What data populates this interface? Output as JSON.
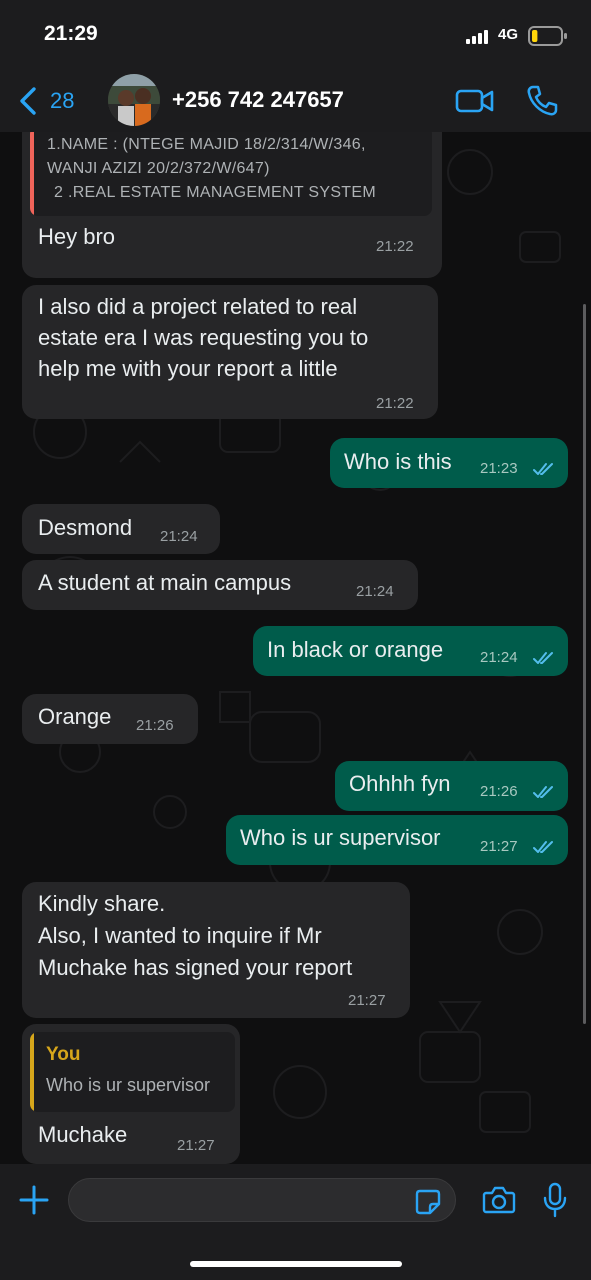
{
  "status_bar": {
    "time": "21:29",
    "network": "4G",
    "battery_level": 0.2,
    "battery_color": "#ffd60a"
  },
  "header": {
    "back_count": "28",
    "contact": "+256 742 247657",
    "accent": "#2aa4f4"
  },
  "messages": [
    {
      "direction": "in",
      "quoted_lines": [
        "1.NAME : (NTEGE MAJID 18/2/314/W/346,",
        "WANJI AZIZI 20/2/372/W/647)",
        "2 .REAL ESTATE MANAGEMENT SYSTEM"
      ],
      "text": "Hey bro",
      "time": "21:22"
    },
    {
      "direction": "in",
      "lines": [
        "I also did a project related to real",
        "estate era I was requesting you to",
        "help me with your report a little"
      ],
      "time": "21:22"
    },
    {
      "direction": "out",
      "text": "Who is this",
      "time": "21:23"
    },
    {
      "direction": "in",
      "text": "Desmond",
      "time": "21:24"
    },
    {
      "direction": "in",
      "text": "A student at main campus",
      "time": "21:24"
    },
    {
      "direction": "out",
      "text": "In black or orange",
      "time": "21:24"
    },
    {
      "direction": "in",
      "text": "Orange",
      "time": "21:26"
    },
    {
      "direction": "out",
      "text": "Ohhhh fyn",
      "time": "21:26"
    },
    {
      "direction": "out",
      "text": "Who is ur supervisor",
      "time": "21:27"
    },
    {
      "direction": "in",
      "lines": [
        "Kindly share.",
        "Also, I wanted to inquire if Mr",
        "Muchake has signed your report"
      ],
      "time": "21:27"
    },
    {
      "direction": "in",
      "reply_author": "You",
      "reply_text": "Who is ur supervisor",
      "text": "Muchake",
      "time": "21:27"
    }
  ],
  "colors": {
    "incoming": "#262628",
    "outgoing": "#005c4b",
    "read_ticks": "#53bdeb",
    "quote_bar_pink": "#f0645a",
    "quote_bar_you": "#d6a61b"
  },
  "icons": [
    "back-chevron",
    "video-camera",
    "phone",
    "plus",
    "sticker",
    "camera",
    "microphone",
    "double-check"
  ]
}
